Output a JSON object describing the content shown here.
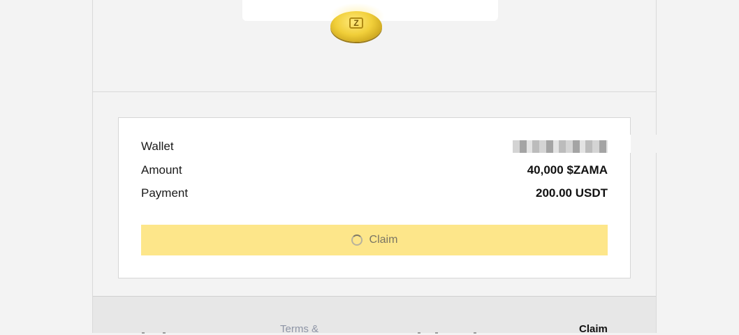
{
  "details": {
    "wallet_label": "Wallet",
    "amount_label": "Amount",
    "amount_value": "40,000 $ZAMA",
    "payment_label": "Payment",
    "payment_value": "200.00 USDT"
  },
  "claim_button": {
    "label": "Claim",
    "state": "loading"
  },
  "footer": {
    "terms_label": "Terms &",
    "claim_label": "Claim"
  },
  "icons": {
    "coin": "zama-coin-icon",
    "spinner": "loading-spinner-icon"
  },
  "colors": {
    "claim_button_bg": "#fde68a",
    "background": "#f3f3f3",
    "card_bg": "#ffffff"
  }
}
